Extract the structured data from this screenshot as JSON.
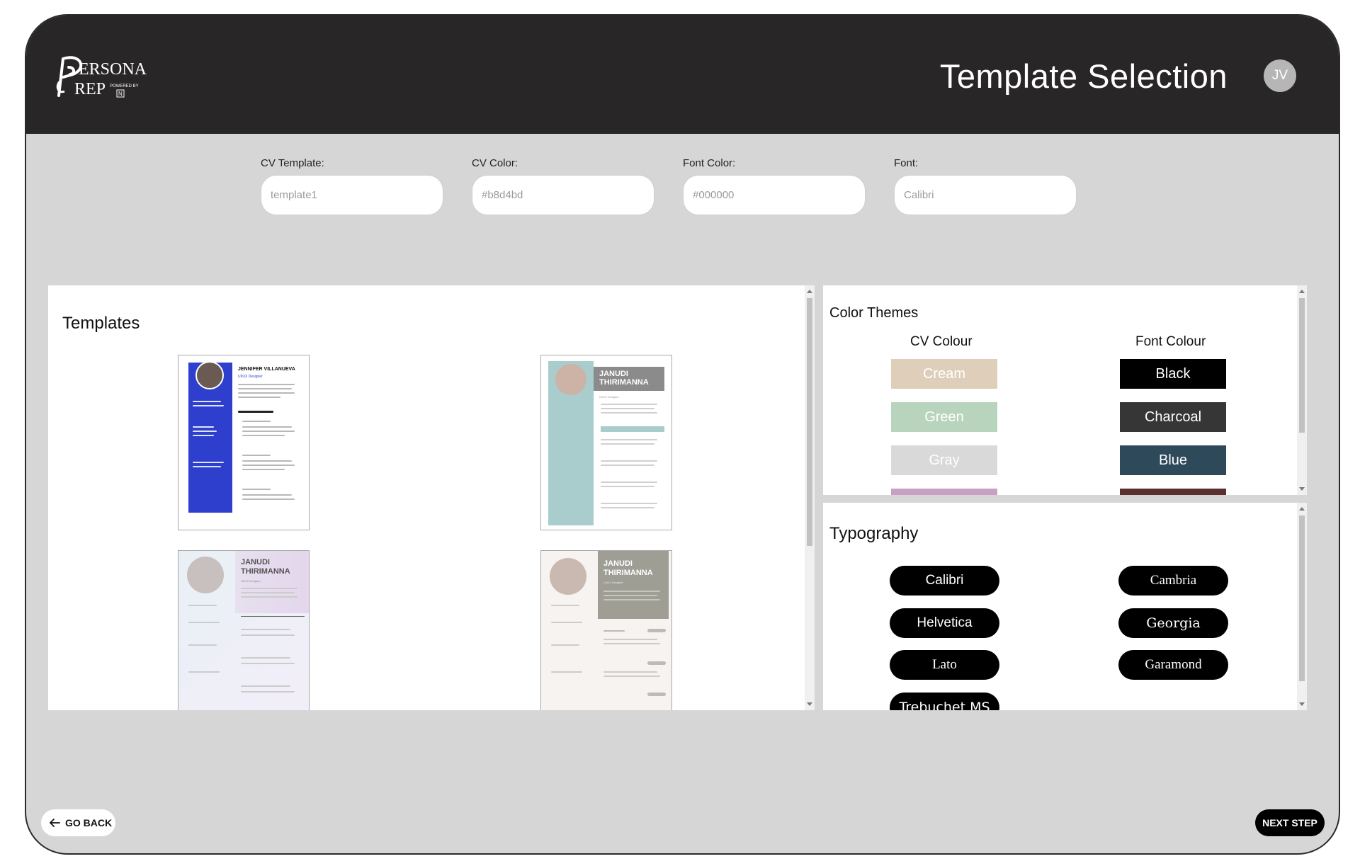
{
  "header": {
    "logo_text": "PERSONA PREP",
    "logo_sub": "POWERED BY",
    "title": "Template Selection",
    "avatar_initials": "JV"
  },
  "fields": [
    {
      "label": "CV Template:",
      "value": "template1"
    },
    {
      "label": "CV Color:",
      "value": "#b8d4bd"
    },
    {
      "label": "Font Color:",
      "value": "#000000"
    },
    {
      "label": "Font:",
      "value": "Calibri"
    }
  ],
  "templates_panel": {
    "title": "Templates",
    "items": [
      {
        "name": "JENNIFER VILLANUEVA",
        "role": "UI/UX Designer",
        "accent": "#2d3fcc"
      },
      {
        "name": "JANUDI THIRIMANNA",
        "role": "UI/UX Designer",
        "accent": "#a8cdcc"
      },
      {
        "name": "JANUDI THIRIMANNA",
        "role": "UI/UX Designer",
        "accent": "#d9d3ea"
      },
      {
        "name": "JANUDI THIRIMANNA",
        "role": "UI/UX Designer",
        "accent": "#9e9e95"
      }
    ]
  },
  "color_themes": {
    "title": "Color Themes",
    "cv_colour_heading": "CV Colour",
    "font_colour_heading": "Font Colour",
    "cv_colours": [
      {
        "label": "Cream",
        "color": "#dfcfba"
      },
      {
        "label": "Green",
        "color": "#b8d4bd"
      },
      {
        "label": "Gray",
        "color": "#d9d9d9"
      },
      {
        "label": "",
        "color": "#c8a0c4"
      }
    ],
    "font_colours": [
      {
        "label": "Black",
        "color": "#000000"
      },
      {
        "label": "Charcoal",
        "color": "#363636"
      },
      {
        "label": "Blue",
        "color": "#2e4a5a"
      },
      {
        "label": "",
        "color": "#5a3030"
      }
    ]
  },
  "typography": {
    "title": "Typography",
    "fonts": [
      "Calibri",
      "Cambria",
      "Helvetica",
      "Georgia",
      "Lato",
      "Garamond",
      "Trebuchet MS"
    ]
  },
  "footer": {
    "back_label": "GO BACK",
    "next_label": "NEXT STEP"
  }
}
